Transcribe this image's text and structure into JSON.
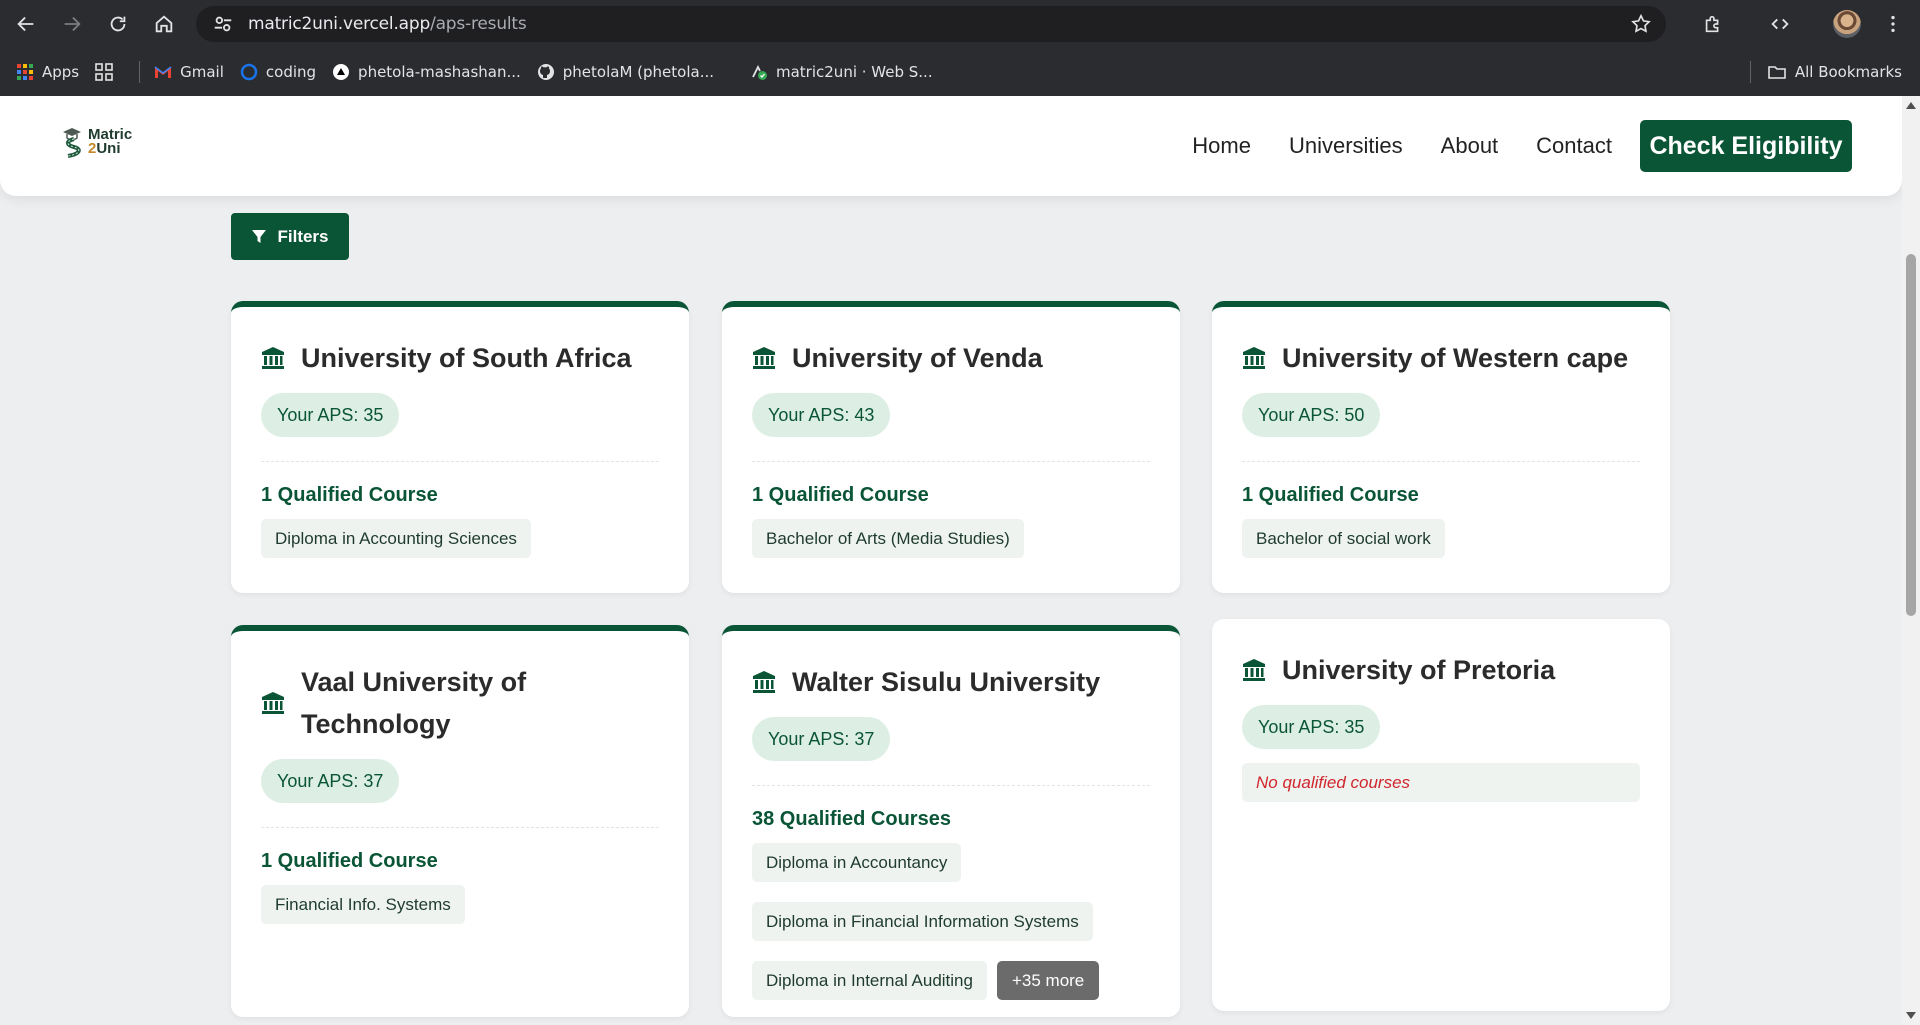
{
  "browser": {
    "url_host": "matric2uni.vercel.app",
    "url_path": "/aps-results",
    "bookmarks": [
      {
        "label": "Apps",
        "icon": "apps-grid-icon"
      },
      {
        "label": "",
        "icon": "tab-groups-icon"
      },
      {
        "label": "Gmail",
        "icon": "gmail-icon"
      },
      {
        "label": "coding",
        "icon": "coding-icon"
      },
      {
        "label": "phetola-mashashan...",
        "icon": "vercel-icon"
      },
      {
        "label": "phetolaM (phetola...",
        "icon": "github-icon"
      },
      {
        "label": "matric2uni · Web S...",
        "icon": "web-app-icon"
      }
    ],
    "all_bookmarks": "All Bookmarks"
  },
  "header": {
    "logo_top": "Matric",
    "logo_num": "2",
    "logo_bottom": "Uni",
    "nav": [
      "Home",
      "Universities",
      "About",
      "Contact"
    ],
    "cta": "Check Eligibility"
  },
  "filters_label": "Filters",
  "cards": [
    {
      "name": "University of South Africa",
      "aps": "Your APS: 35",
      "qualified": "1 Qualified Course",
      "courses": [
        "Diploma in Accounting Sciences"
      ]
    },
    {
      "name": "University of Venda",
      "aps": "Your APS: 43",
      "qualified": "1 Qualified Course",
      "courses": [
        "Bachelor of Arts (Media Studies)"
      ]
    },
    {
      "name": "University of Western cape",
      "aps": "Your APS: 50",
      "qualified": "1 Qualified Course",
      "courses": [
        "Bachelor of social work"
      ]
    },
    {
      "name": "Vaal University of Technology",
      "aps": "Your APS: 37",
      "qualified": "1 Qualified Course",
      "courses": [
        "Financial Info. Systems"
      ]
    },
    {
      "name": "Walter Sisulu University",
      "aps": "Your APS: 37",
      "qualified": "38 Qualified Courses",
      "courses": [
        "Diploma in Accountancy",
        "Diploma in Financial Information Systems",
        "Diploma in Internal Auditing"
      ],
      "more": "+35 more"
    },
    {
      "name": "University of Pretoria",
      "aps": "Your APS: 35",
      "no_courses": "No qualified courses"
    }
  ],
  "colors": {
    "brand_green": "#0b5537",
    "badge_bg": "#ddefe5",
    "error_red": "#d0262d"
  }
}
